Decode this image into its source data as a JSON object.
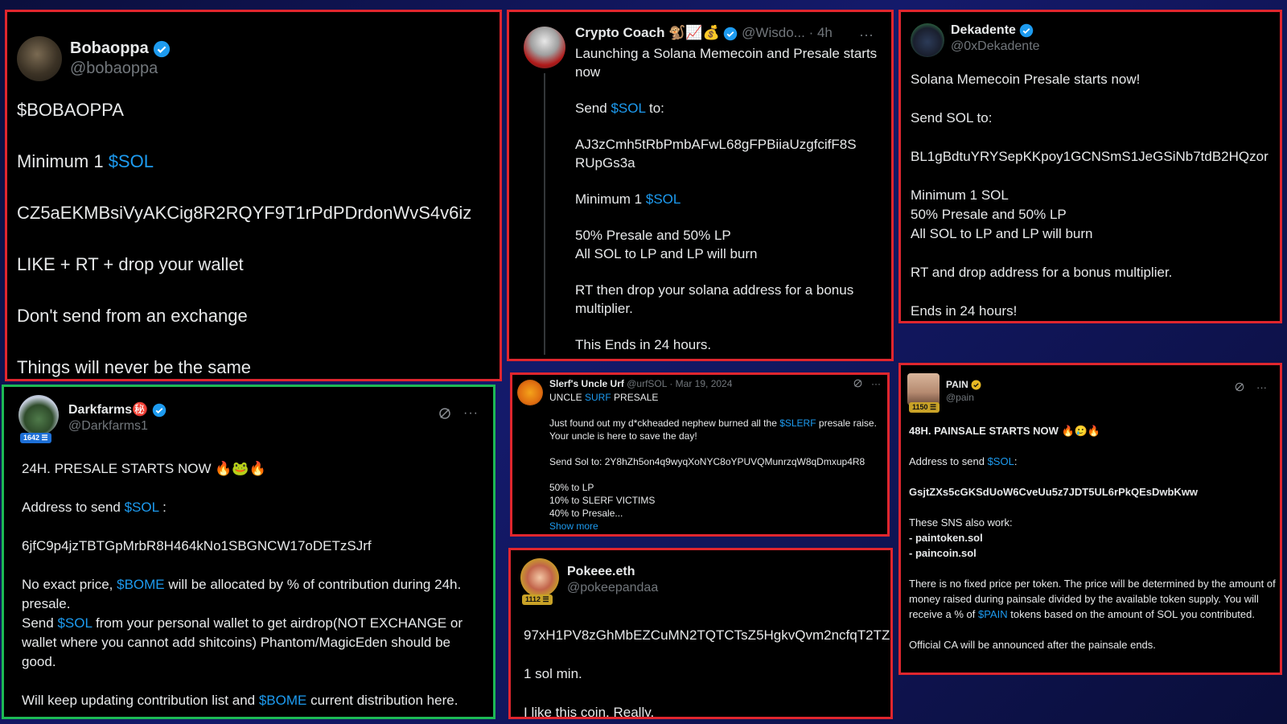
{
  "colors": {
    "border_red": "#e0262e",
    "border_green": "#1db954",
    "link_blue": "#1d9bf0",
    "background": "#0b0f3d"
  },
  "card1": {
    "name": "Bobaoppa",
    "handle": "@bobaoppa",
    "line1": "$BOBAOPPA",
    "line2_prefix": "Minimum 1 ",
    "line2_link": "$SOL",
    "address": "CZ5aEKMBsiVyAKCig8R2RQYF9T1rPdPDrdonWvS4v6iz",
    "line4": "LIKE + RT + drop your wallet",
    "line5": "Don't send from an exchange",
    "line6": "Things will never be the same"
  },
  "card2": {
    "name": "Crypto Coach 🐒📈💰",
    "handle": "@Wisdo...",
    "time": "· 4h",
    "intro": "Launching a Solana Memecoin and Presale starts now",
    "send_prefix": "Send ",
    "send_link": "$SOL",
    "send_suffix": " to:",
    "address_line1": "AJ3zCmh5tRbPmbAFwL68gFPBiiaUzgfcifF8S",
    "address_line2": "RUpGs3a",
    "min_prefix": "Minimum 1 ",
    "min_link": "$SOL",
    "split1": "50% Presale and 50% LP",
    "split2": "All SOL to LP and LP will burn",
    "rt": "RT then drop your solana address for a bonus multiplier.",
    "ends": "This Ends in 24 hours."
  },
  "card3": {
    "name": "Dekadente",
    "handle": "@0xDekadente",
    "l1": "Solana Memecoin Presale starts now!",
    "l2": "Send SOL to:",
    "address": "BL1gBdtuYRYSepKKpoy1GCNSmS1JeGSiNb7tdB2HQzor",
    "l4": "Minimum 1 SOL",
    "l5": "50% Presale and 50% LP",
    "l6": "All SOL to LP and LP will burn",
    "l7": "RT and drop address for a bonus multiplier.",
    "l8": "Ends in 24 hours!"
  },
  "card4": {
    "name": "Darkfarms",
    "name_emoji": "㊙️",
    "handle": "@Darkfarms1",
    "badge": "1642 ☰",
    "headline": "24H. PRESALE STARTS NOW 🔥🐸🔥",
    "addr_prefix": "Address to send ",
    "addr_link": "$SOL",
    "addr_suffix": " :",
    "address": "6jfC9p4jzTBTGpMrbR8H464kNo1SBGNCW17oDETzSJrf",
    "p1_prefix": "No exact price, ",
    "p1_link": "$BOME",
    "p1_suffix": " will be allocated by % of contribution during 24h. presale.",
    "p2_prefix": "Send ",
    "p2_link": "$SOL",
    "p2_suffix": " from your personal wallet to get airdrop(NOT EXCHANGE or wallet where you cannot add shitcoins) Phantom/MagicEden should be good.",
    "p3_prefix": "Will keep updating contribution list and ",
    "p3_link": "$BOME",
    "p3_suffix": " current distribution here."
  },
  "card5": {
    "name": "Slerf's Uncle Urf",
    "handle": "@urfSOL",
    "time": "· Mar 19, 2024",
    "title_prefix": "UNCLE ",
    "title_link": "SURF",
    "title_suffix": " PRESALE",
    "p1_prefix": "Just found out my d*ckheaded nephew burned all the ",
    "p1_link": "$SLERF",
    "p1_suffix": " presale raise. Your uncle is here to save the day!",
    "send": "Send Sol to: 2Y8hZh5on4q9wyqXoNYC8oYPUVQMunrzqW8qDmxup4R8",
    "s1": "50% to LP",
    "s2": "10% to SLERF VICTIMS",
    "s3": "40% to Presale...",
    "show_more": "Show more"
  },
  "card6": {
    "name": "Pokeee.eth",
    "handle": "@pokeepandaa",
    "badge": "1112 ☰",
    "address": "97xH1PV8zGhMbEZCuMN2TQTCTsZ5HgkvQvm2ncfqT2TZ",
    "l2": "1 sol min.",
    "l3": "I like this coin. Really."
  },
  "card7": {
    "name": "PAIN",
    "handle": "@pain",
    "badge": "1150 ☰",
    "headline": "48H. PAINSALE STARTS NOW 🔥🥲🔥",
    "addr_prefix": "Address to send ",
    "addr_link": "$SOL",
    "addr_suffix": ":",
    "address": "GsjtZXs5cGKSdUoW6CveUu5z7JDT5UL6rPkQEsDwbKww",
    "sns": "These SNS also work:",
    "sns1": "- paintoken.sol",
    "sns2": "- paincoin.sol",
    "p1_prefix": "There is no fixed price per token. The price will be determined by the amount of money raised during painsale divided by the available token supply. You will receive a % of ",
    "p1_link": "$PAIN",
    "p1_suffix": " tokens based on the amount of SOL you contributed.",
    "p2": "Official CA will be announced after the painsale ends."
  },
  "icons": {
    "verified": "verified-badge-icon",
    "more": "more-options-icon",
    "grok": "grok-icon"
  }
}
